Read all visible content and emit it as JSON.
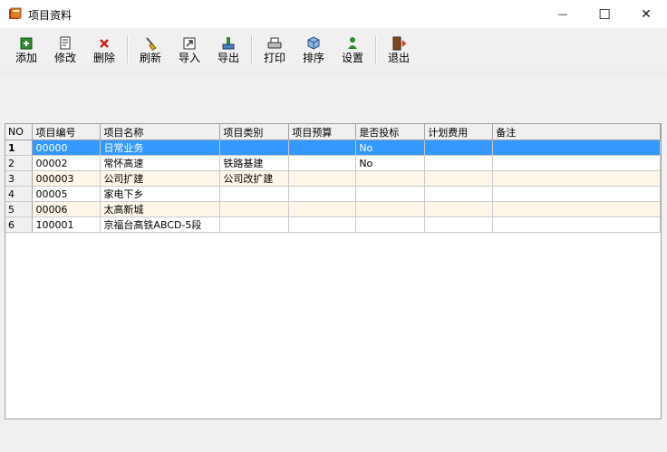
{
  "window": {
    "title": "项目资料",
    "minimize_glyph": "—",
    "maximize_glyph": "☐",
    "close_glyph": "✕"
  },
  "toolbar": {
    "add": "添加",
    "edit": "修改",
    "delete": "删除",
    "refresh": "刷新",
    "import": "导入",
    "export": "导出",
    "print": "打印",
    "sort": "排序",
    "settings": "设置",
    "exit": "退出"
  },
  "table": {
    "headers": [
      "NO",
      "项目编号",
      "项目名称",
      "项目类别",
      "项目预算",
      "是否投标",
      "计划费用",
      "备注"
    ],
    "rows": [
      [
        "1",
        "00000",
        "日常业务",
        "",
        "",
        "No",
        "",
        ""
      ],
      [
        "2",
        "00002",
        "常怀高速",
        "铁路基建",
        "",
        "No",
        "",
        ""
      ],
      [
        "3",
        "000003",
        "公司扩建",
        "公司改扩建",
        "",
        "",
        "",
        ""
      ],
      [
        "4",
        "00005",
        "家电下乡",
        "",
        "",
        "",
        "",
        ""
      ],
      [
        "5",
        "00006",
        "太高新城",
        "",
        "",
        "",
        "",
        ""
      ],
      [
        "6",
        "100001",
        "京福台高铁ABCD-5段",
        "",
        "",
        "",
        "",
        ""
      ]
    ],
    "selected_row": 0
  },
  "colors": {
    "selection": "#3399ff",
    "alt_row": "#fdf6e9"
  },
  "icons": [
    "add-icon",
    "edit-icon",
    "delete-icon",
    "refresh-icon",
    "import-icon",
    "export-icon",
    "print-icon",
    "sort-icon",
    "settings-icon",
    "exit-icon"
  ]
}
